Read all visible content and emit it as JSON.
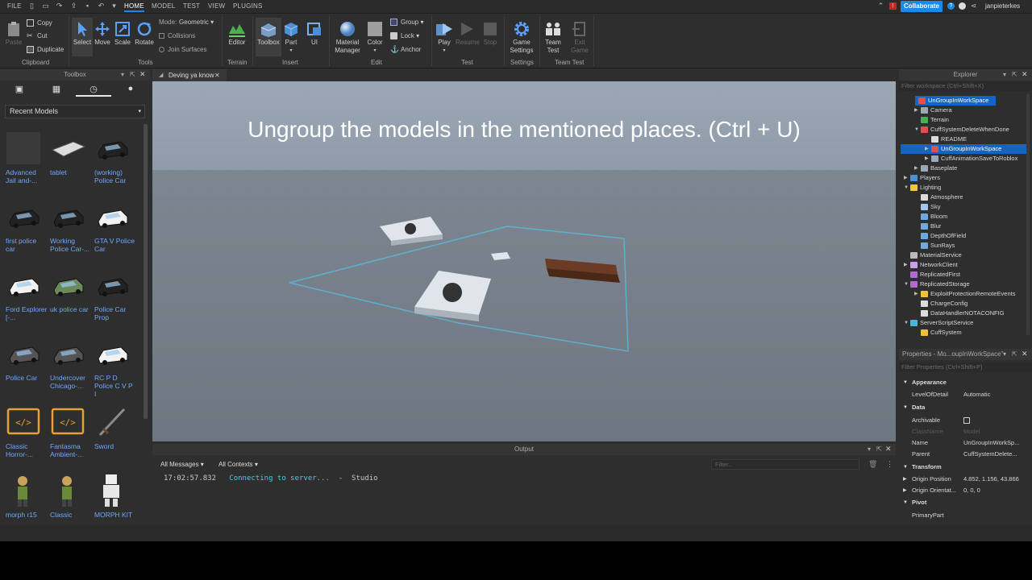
{
  "menubar": {
    "file": "FILE",
    "tabs": [
      "HOME",
      "MODEL",
      "TEST",
      "VIEW",
      "PLUGINS"
    ],
    "collaborate": "Collaborate",
    "username": "janpieterkes"
  },
  "ribbon": {
    "clipboard": {
      "paste": "Paste",
      "copy": "Copy",
      "cut": "Cut",
      "duplicate": "Duplicate",
      "group_label": "Clipboard"
    },
    "tools": {
      "select": "Select",
      "move": "Move",
      "scale": "Scale",
      "rotate": "Rotate",
      "mode_label": "Mode:",
      "mode_value": "Geometric",
      "collisions": "Collisions",
      "join_surfaces": "Join Surfaces",
      "group_label": "Tools"
    },
    "terrain": {
      "editor": "Editor",
      "group_label": "Terrain"
    },
    "insert": {
      "toolbox": "Toolbox",
      "part": "Part",
      "ui": "UI",
      "group_label": "Insert"
    },
    "edit": {
      "material_manager_1": "Material",
      "material_manager_2": "Manager",
      "color": "Color",
      "group": "Group",
      "lock": "Lock",
      "anchor": "Anchor",
      "group_label": "Edit"
    },
    "test": {
      "play": "Play",
      "resume": "Resume",
      "stop": "Stop",
      "group_label": "Test"
    },
    "settings": {
      "game_settings_1": "Game",
      "game_settings_2": "Settings",
      "group_label": "Settings"
    },
    "team_test": {
      "team_test_1": "Team",
      "team_test_2": "Test",
      "exit_game_1": "Exit",
      "exit_game_2": "Game",
      "group_label": "Team Test"
    }
  },
  "toolbox": {
    "title": "Toolbox",
    "category": "Recent Models",
    "items": [
      {
        "label": "Advanced Jail and-..."
      },
      {
        "label": "tablet"
      },
      {
        "label": "(working) Police Car"
      },
      {
        "label": "first police car"
      },
      {
        "label": "Working Police Car-..."
      },
      {
        "label": "GTA V Police Car"
      },
      {
        "label": "Ford Explorer [-..."
      },
      {
        "label": "uk police car"
      },
      {
        "label": "Police Car Prop"
      },
      {
        "label": "Police Car"
      },
      {
        "label": "Undercover Chicago-..."
      },
      {
        "label": "RC P D Police C V P I"
      },
      {
        "label": "Classic Horror-..."
      },
      {
        "label": "Fantasma Ambient-..."
      },
      {
        "label": "Sword"
      },
      {
        "label": "morph r15"
      },
      {
        "label": "Classic"
      },
      {
        "label": "MORPH KIT"
      }
    ]
  },
  "document": {
    "tab_title": "Deving ya know"
  },
  "viewport": {
    "caption": "Ungroup the models in the mentioned places. (Ctrl + U)"
  },
  "output": {
    "title": "Output",
    "messages_filter": "All Messages",
    "contexts_filter": "All Contexts",
    "filter_placeholder": "Filter...",
    "log_time": "17:02:57.832",
    "log_message": "Connecting to server...",
    "log_separator": "-",
    "log_source": "Studio"
  },
  "explorer": {
    "title": "Explorer",
    "filter_placeholder": "Filter workspace (Ctrl+Shift+X)",
    "rows": [
      {
        "label": "UnGroupInWorkSpace",
        "color": "#e05050"
      },
      {
        "label": "Camera",
        "color": "#9aa7b5"
      },
      {
        "label": "Terrain",
        "color": "#4caf50"
      },
      {
        "label": "CuffSystemDeleteWhenDone",
        "color": "#e05050"
      },
      {
        "label": "README",
        "color": "#dcdcdc"
      },
      {
        "label": "UnGroupInWorkSpace",
        "color": "#e05050"
      },
      {
        "label": "CuffAnimationSaveToRoblox",
        "color": "#9aa7b5"
      },
      {
        "label": "Baseplate",
        "color": "#9aa7b5"
      },
      {
        "label": "Players",
        "color": "#4a90d9"
      },
      {
        "label": "Lighting",
        "color": "#f5c542"
      },
      {
        "label": "Atmosphere",
        "color": "#dcdcdc"
      },
      {
        "label": "Sky",
        "color": "#9ec8ee"
      },
      {
        "label": "Bloom",
        "color": "#6fa8dc"
      },
      {
        "label": "Blur",
        "color": "#6fa8dc"
      },
      {
        "label": "DepthOfField",
        "color": "#6fa8dc"
      },
      {
        "label": "SunRays",
        "color": "#6fa8dc"
      },
      {
        "label": "MaterialService",
        "color": "#bbbbbb"
      },
      {
        "label": "NetworkClient",
        "color": "#c8a0e8"
      },
      {
        "label": "ReplicatedFirst",
        "color": "#b36ad0"
      },
      {
        "label": "ReplicatedStorage",
        "color": "#b36ad0"
      },
      {
        "label": "ExploitProtectionRemoteEvents",
        "color": "#f0c040"
      },
      {
        "label": "ChargeConfig",
        "color": "#dcdcdc"
      },
      {
        "label": "DataHandlerNOTACONFIG",
        "color": "#dcdcdc"
      },
      {
        "label": "ServerScriptService",
        "color": "#4fb5d6"
      },
      {
        "label": "CuffSystem",
        "color": "#f0c040"
      }
    ]
  },
  "properties": {
    "title": "Properties - Mo...oupInWorkSpace\"",
    "filter_placeholder": "Filter Properties (Ctrl+Shift+P)",
    "sections": {
      "appearance": "Appearance",
      "data": "Data",
      "transform": "Transform",
      "pivot": "Pivot"
    },
    "rows": {
      "level_of_detail": {
        "name": "LevelOfDetail",
        "value": "Automatic"
      },
      "archivable": {
        "name": "Archivable",
        "value": ""
      },
      "class_name": {
        "name": "ClassName",
        "value": "Model"
      },
      "name": {
        "name": "Name",
        "value": "UnGroupInWorkSp..."
      },
      "parent": {
        "name": "Parent",
        "value": "CuffSystemDelete..."
      },
      "origin_position": {
        "name": "Origin Position",
        "value": "4.852, 1.156, 43.866"
      },
      "origin_orientation": {
        "name": "Origin Orientat...",
        "value": "0, 0, 0"
      },
      "primary_part": {
        "name": "PrimaryPart",
        "value": ""
      }
    }
  }
}
